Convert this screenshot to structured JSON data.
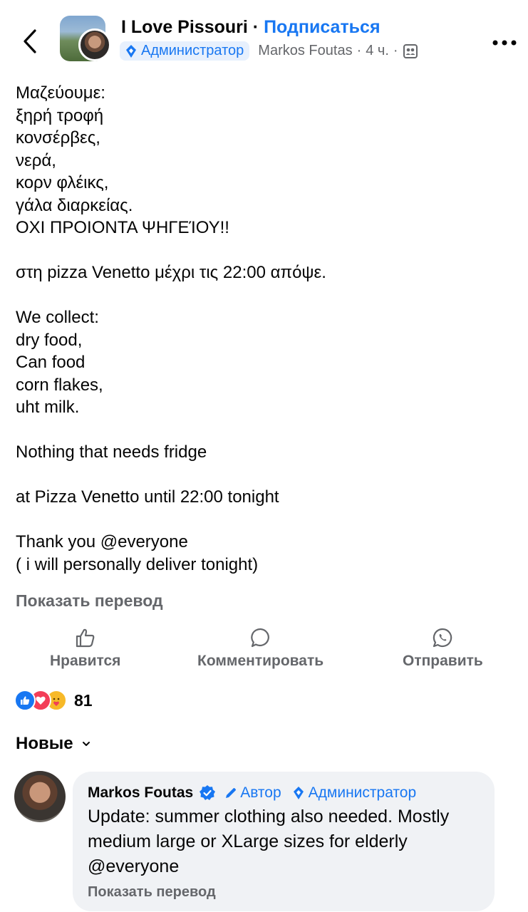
{
  "header": {
    "group_name": "I Love Pissouri",
    "separator": "·",
    "subscribe_label": "Подписаться",
    "role_badge": "Администратор",
    "author": "Markos Foutas",
    "meta_sep": "·",
    "time": "4 ч.",
    "meta_sep2": "·"
  },
  "post": {
    "lines": [
      "Μαζεύουμε:",
      "ξηρή τροφή",
      "κονσέρβες,",
      "νερά,",
      "κορν φλέικς,",
      "γάλα διαρκείας.",
      "ΟΧΙ ΠΡΟΙΟΝΤΑ ΨΗΓΕΊΟΥ!!",
      "",
      "στη pizza Venetto μέχρι τις 22:00 απόψε.",
      "",
      "We collect:",
      "dry food,",
      "Can food",
      "corn flakes,",
      "uht milk.",
      "",
      "Nothing that needs fridge",
      "",
      "at Pizza Venetto until 22:00 tonight",
      "",
      "Thank you @everyone",
      "( i will personally deliver tonight)"
    ],
    "translate_label": "Показать перевод"
  },
  "actions": {
    "like_label": "Нравится",
    "comment_label": "Комментировать",
    "share_label": "Отправить"
  },
  "reactions": {
    "count": "81",
    "icons": [
      "like-icon",
      "love-icon",
      "care-icon"
    ]
  },
  "comments": {
    "sort_label": "Новые",
    "items": [
      {
        "author": "Markos Foutas",
        "author_tag": "Автор",
        "role_tag": "Администратор",
        "text": "Update: summer clothing also needed. Mostly medium large or XLarge sizes for elderly @everyone",
        "translate_label": "Показать перевод"
      }
    ]
  },
  "colors": {
    "accent": "#1877f2",
    "secondary_text": "#65676b",
    "bubble_bg": "#f0f2f5",
    "love": "#f33e58",
    "care": "#f7b928"
  }
}
